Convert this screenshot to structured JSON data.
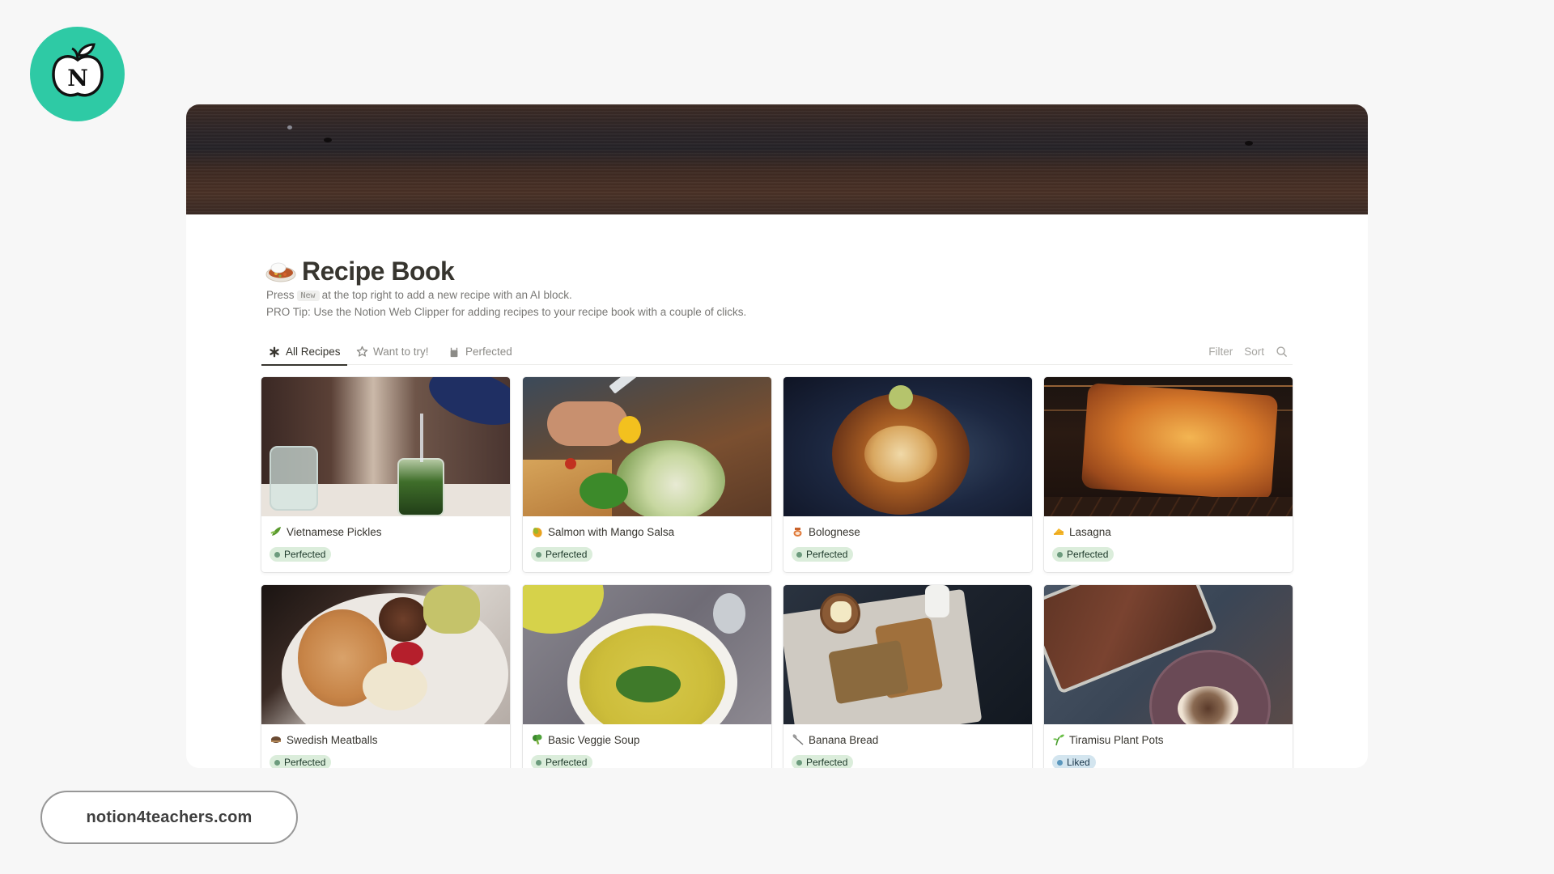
{
  "brand": {
    "logo_icon": "apple-n-logo-icon",
    "logo_letter": "N",
    "logo_color": "#2ecaa5",
    "footer_link": "notion4teachers.com"
  },
  "page": {
    "icon": "rice-curry-icon",
    "title": "Recipe Book",
    "desc_line1_before": "Press",
    "desc_kbd": "New",
    "desc_line1_after": "at the top right to add a new recipe with an AI block.",
    "desc_line2": "PRO Tip: Use the Notion Web Clipper for adding recipes to your recipe book with a couple of clicks."
  },
  "views": {
    "tabs": [
      {
        "label": "All Recipes",
        "icon": "asterisk-icon",
        "active": true
      },
      {
        "label": "Want to try!",
        "icon": "star-icon",
        "active": false
      },
      {
        "label": "Perfected",
        "icon": "chef-apron-icon",
        "active": false
      }
    ],
    "tools": {
      "filter": "Filter",
      "sort": "Sort",
      "search_icon": "search-icon"
    }
  },
  "recipes": [
    {
      "name": "Vietnamese Pickles",
      "emoji": "cucumber-icon",
      "status": "Perfected",
      "status_color": "green"
    },
    {
      "name": "Salmon with Mango Salsa",
      "emoji": "mango-icon",
      "status": "Perfected",
      "status_color": "green"
    },
    {
      "name": "Bolognese",
      "emoji": "sauce-jar-icon",
      "status": "Perfected",
      "status_color": "green"
    },
    {
      "name": "Lasagna",
      "emoji": "cheese-icon",
      "status": "Perfected",
      "status_color": "green"
    },
    {
      "name": "Swedish Meatballs",
      "emoji": "meatball-icon",
      "status": "Perfected",
      "status_color": "green"
    },
    {
      "name": "Basic Veggie Soup",
      "emoji": "broccoli-icon",
      "status": "Perfected",
      "status_color": "green"
    },
    {
      "name": "Banana Bread",
      "emoji": "spoon-icon",
      "status": "Perfected",
      "status_color": "green"
    },
    {
      "name": "Tiramisu Plant Pots",
      "emoji": "seedling-icon",
      "status": "Liked",
      "status_color": "blue"
    }
  ],
  "colors": {
    "status_green_bg": "#dbeddb",
    "status_blue_bg": "#d3e5ef",
    "text_primary": "#37352f",
    "text_secondary": "#787774"
  }
}
